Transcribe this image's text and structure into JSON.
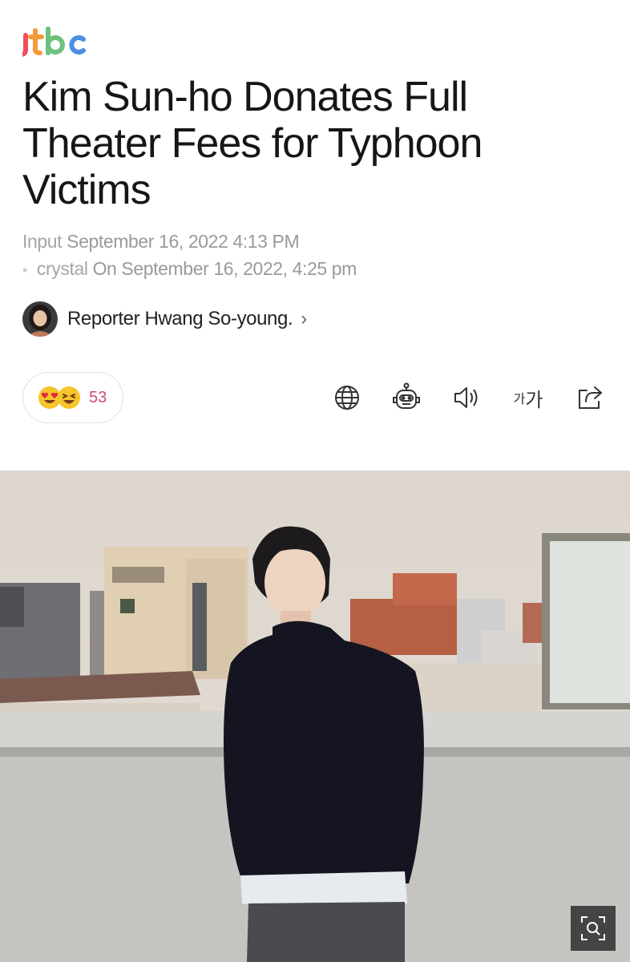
{
  "brand": {
    "logo_text": "jtbc"
  },
  "article": {
    "title": "Kim Sun-ho Donates Full Theater Fees for Typhoon Victims",
    "input_label": "Input",
    "input_time": "September 16, 2022 4:13 PM",
    "update_label": "crystal",
    "update_time": "On September 16, 2022, 4:25 pm"
  },
  "reporter": {
    "name": "Reporter Hwang So-young.",
    "chevron": "›"
  },
  "reactions": {
    "count": "53",
    "icons": [
      "heart-eyes-emoji",
      "laughing-emoji"
    ]
  },
  "toolbar": {
    "items": [
      "globe-icon",
      "robot-icon",
      "speaker-icon",
      "font-size-icon",
      "share-icon"
    ],
    "font_small": "가",
    "font_large": "가"
  },
  "photo": {
    "zoom_icon": "zoom-icon"
  },
  "colors": {
    "reaction_count": "#d04a7c",
    "meta_text": "#9a9a9a"
  }
}
